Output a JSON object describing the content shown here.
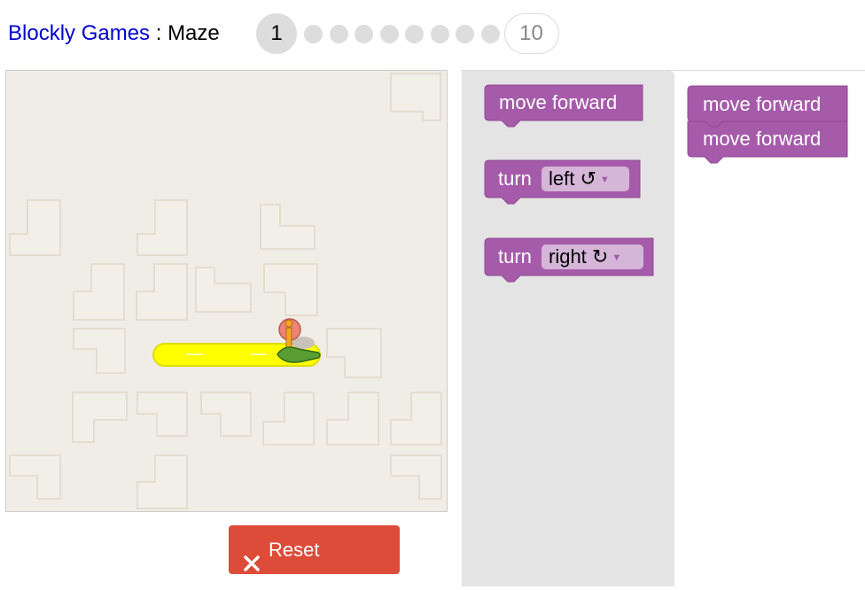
{
  "header": {
    "brand": "Blockly Games",
    "separator": " : ",
    "game": "Maze"
  },
  "levels": {
    "current": "1",
    "last": "10"
  },
  "reset_button": {
    "label": "Reset"
  },
  "toolbox": {
    "move_forward": "move forward",
    "turn_left": {
      "label": "turn",
      "option": "left ↺"
    },
    "turn_right": {
      "label": "turn",
      "option": "right ↻"
    }
  },
  "workspace": {
    "block1": "move forward",
    "block2": "move forward"
  },
  "colors": {
    "block": "#a55ba9",
    "reset": "#dd4b39",
    "path": "#ffff00",
    "maze_bg": "#f0ede7"
  }
}
